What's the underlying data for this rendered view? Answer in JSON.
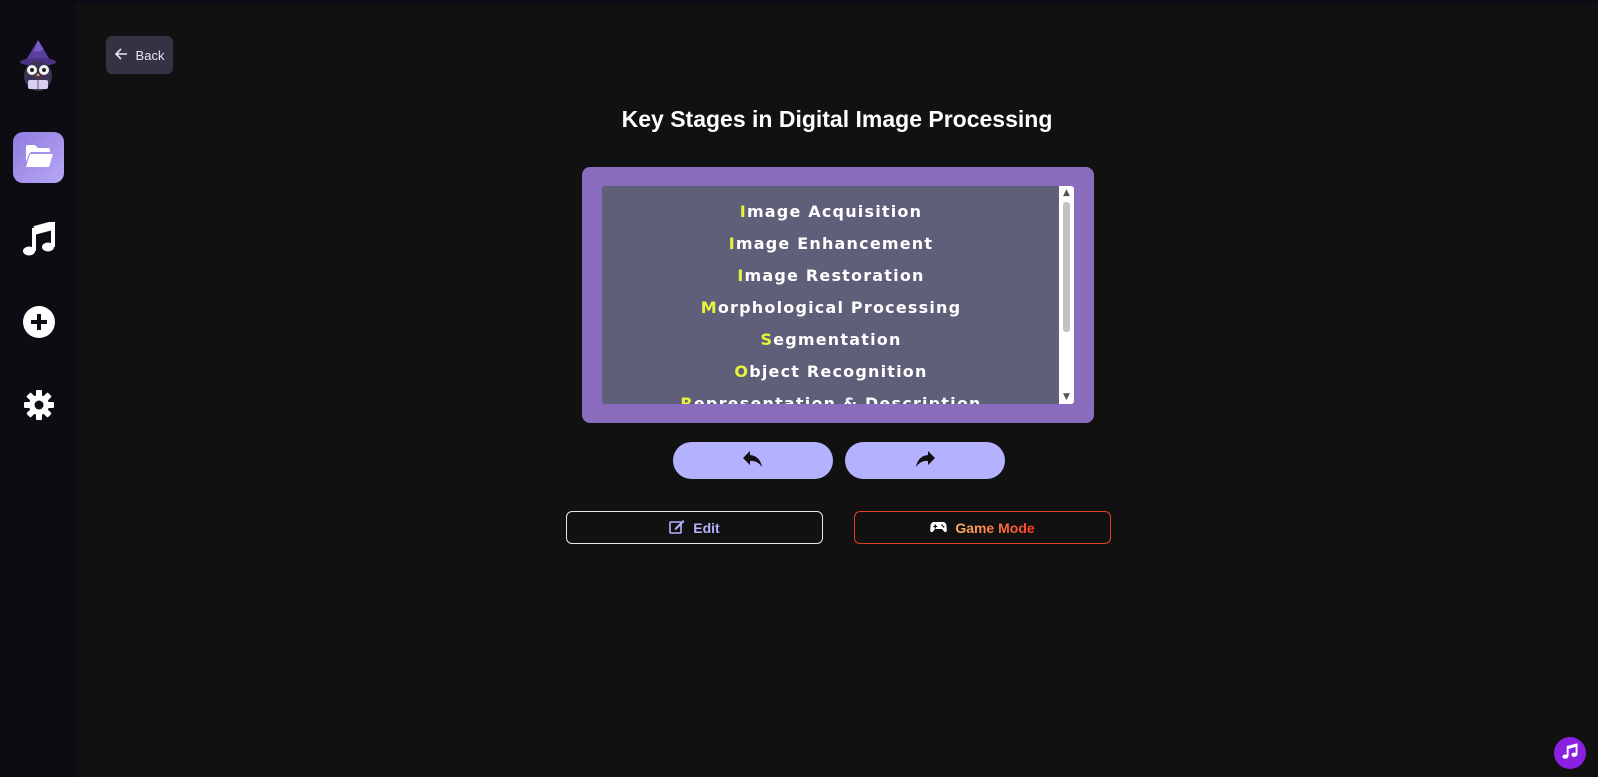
{
  "sidebar": {
    "items": [
      {
        "name": "folder",
        "icon": "folder-open-icon",
        "active": true
      },
      {
        "name": "music",
        "icon": "music-note-icon",
        "active": false
      },
      {
        "name": "add",
        "icon": "plus-circle-icon",
        "active": false
      },
      {
        "name": "settings",
        "icon": "gear-icon",
        "active": false
      }
    ],
    "logo_icon": "wizard-owl-icon"
  },
  "header": {
    "back_label": "Back"
  },
  "main": {
    "title": "Key Stages in Digital Image Processing",
    "list_items": [
      {
        "first": "I",
        "rest": "mage Acquisition"
      },
      {
        "first": "I",
        "rest": "mage Enhancement"
      },
      {
        "first": "I",
        "rest": "mage Restoration"
      },
      {
        "first": "M",
        "rest": "orphological Processing"
      },
      {
        "first": "S",
        "rest": "egmentation"
      },
      {
        "first": "O",
        "rest": "bject Recognition"
      },
      {
        "first": "R",
        "rest": "epresentation & Description"
      }
    ],
    "prev_icon": "reply-arrow-icon",
    "next_icon": "share-arrow-icon",
    "edit_label": "Edit",
    "game_mode_label": "Game Mode"
  },
  "colors": {
    "card": "#8a6cbd",
    "list_bg": "#5f5f7a",
    "highlight_letter": "#e7f53a",
    "nav_button": "#b4b2ff",
    "accent_purple": "#8b20e0",
    "game_orange": "#e0421c"
  }
}
